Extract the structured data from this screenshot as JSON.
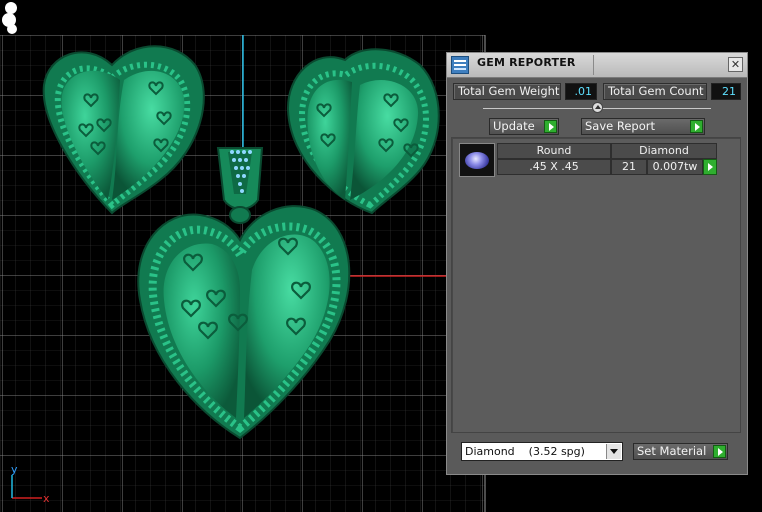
{
  "panel": {
    "title": "GEM REPORTER",
    "close_label": "✕",
    "total_gem_weight_label": "Total Gem Weight",
    "total_gem_weight_value": ".01",
    "total_gem_count_label": "Total Gem Count",
    "total_gem_count_value": "21",
    "update_label": "Update",
    "save_report_label": "Save Report",
    "gem": {
      "shape": "Round",
      "size": ".45 X .45",
      "material": "Diamond",
      "count": "21",
      "weight": "0.007tw"
    },
    "material_select": {
      "name": "Diamond",
      "density": "(3.52 spg)"
    },
    "set_material_label": "Set Material"
  },
  "viewport": {
    "axis_x_label": "x",
    "axis_y_label": "y",
    "grid_color": "#8a8a8a",
    "model_color": "#1f8f63",
    "accent_colors": {
      "x_axis": "#d02020",
      "y_axis": "#20b8e0",
      "gem": "#8fd8ff"
    }
  },
  "icons": {
    "app": "gem-reporter-app-icon",
    "close": "close-icon",
    "go": "play-arrow-icon",
    "dropdown": "chevron-down-icon"
  }
}
